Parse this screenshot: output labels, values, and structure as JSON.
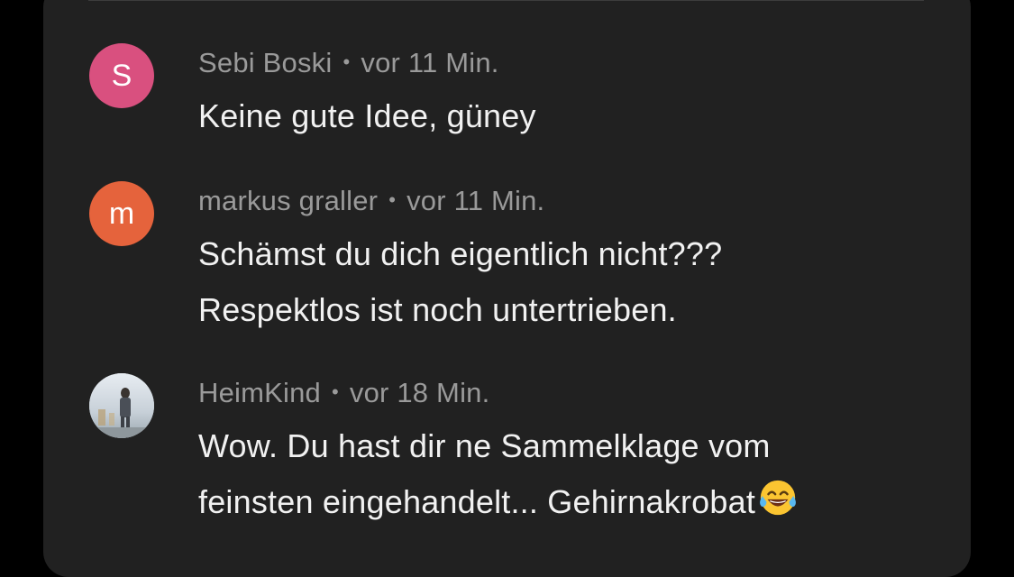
{
  "comments": [
    {
      "author": "Sebi Boski",
      "separator": "•",
      "time": "vor 11 Min.",
      "avatar_letter": "S",
      "avatar_color": "#d9507f",
      "lines": [
        "Keine gute Idee, güney"
      ]
    },
    {
      "author": "markus graller",
      "separator": "•",
      "time": "vor 11 Min.",
      "avatar_letter": "m",
      "avatar_color": "#e5633c",
      "lines": [
        "Schämst du dich eigentlich nicht???",
        "Respektlos ist noch untertrieben."
      ]
    },
    {
      "author": "HeimKind",
      "separator": "•",
      "time": "vor 18 Min.",
      "avatar_letter": "",
      "avatar_color": "#c9d3dc",
      "lines": [
        "Wow. Du hast dir ne Sammelklage vom",
        "feinsten eingehandelt... Gehirnakrobat"
      ],
      "trailing_emoji": "face-with-tears-of-joy-icon"
    }
  ]
}
